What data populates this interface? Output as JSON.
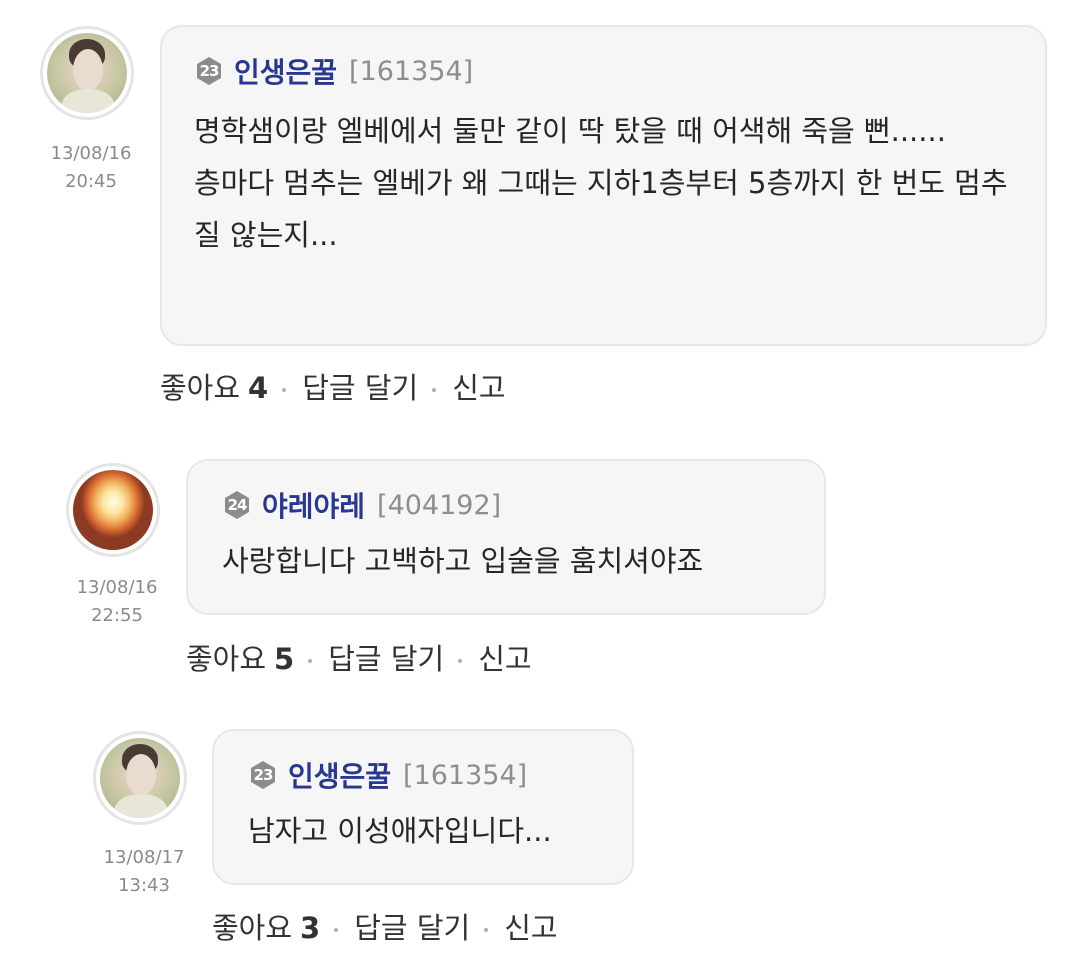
{
  "comments": [
    {
      "level": "23",
      "nickname": "인생은꿀",
      "user_id": "[161354]",
      "date": "13/08/16",
      "time": "20:45",
      "avatar": "woman-photo",
      "text": "명학샘이랑 엘베에서 둘만 같이 딱 탔을 때 어색해 죽을 뻔......\n층마다 멈추는 엘베가 왜 그때는 지하1층부터 5층까지 한 번도 멈추질 않는지...",
      "like_label": "좋아요",
      "like_count": "4",
      "reply_label": "답글 달기",
      "report_label": "신고"
    },
    {
      "level": "24",
      "nickname": "야레야레",
      "user_id": "[404192]",
      "date": "13/08/16",
      "time": "22:55",
      "avatar": "fire-photo",
      "text": "사랑합니다 고백하고 입술을 훔치셔야죠",
      "like_label": "좋아요",
      "like_count": "5",
      "reply_label": "답글 달기",
      "report_label": "신고"
    },
    {
      "level": "23",
      "nickname": "인생은꿀",
      "user_id": "[161354]",
      "date": "13/08/17",
      "time": "13:43",
      "avatar": "woman-photo",
      "text": "남자고 이성애자입니다...",
      "like_label": "좋아요",
      "like_count": "3",
      "reply_label": "답글 달기",
      "report_label": "신고"
    }
  ],
  "colors": {
    "nickname": "#283791",
    "badge": "#8c8c8c",
    "bubble_bg": "#f6f6f7",
    "timestamp": "#8a8a8a"
  }
}
